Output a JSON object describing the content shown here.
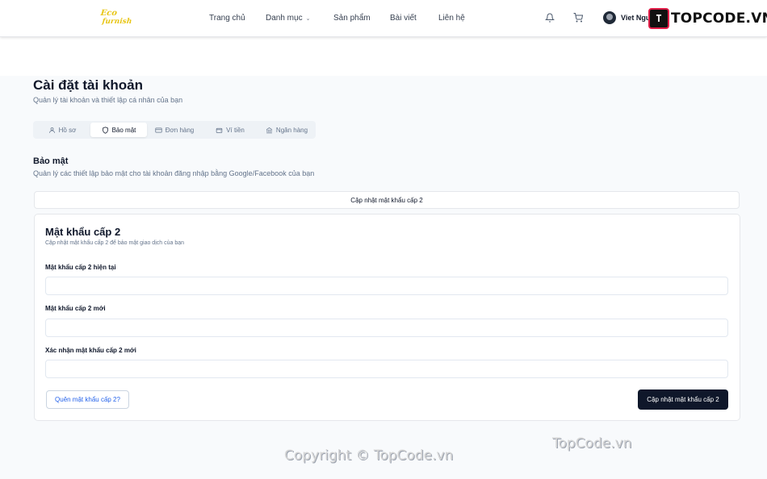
{
  "header": {
    "logo_line1": "Eco",
    "logo_line2": "furnish",
    "nav": [
      "Trang chủ",
      "Danh mục",
      "Sản phẩm",
      "Bài viết",
      "Liên hệ"
    ],
    "user_name": "Viet Ngu",
    "brand_mark": "T",
    "brand_text": "TOPCODE.VN"
  },
  "page": {
    "title": "Cài đặt tài khoản",
    "subtitle": "Quản lý tài khoản và thiết lập cá nhân của bạn"
  },
  "tabs": [
    {
      "label": "Hồ sơ",
      "icon": "user-icon"
    },
    {
      "label": "Bảo mật",
      "icon": "shield-icon"
    },
    {
      "label": "Đơn hàng",
      "icon": "card-icon"
    },
    {
      "label": "Ví tiền",
      "icon": "wallet-icon"
    },
    {
      "label": "Ngân hàng",
      "icon": "bank-icon"
    }
  ],
  "active_tab": "Bảo mật",
  "security": {
    "title": "Bảo mật",
    "subtitle": "Quản lý các thiết lập bảo mật cho tài khoản đăng nhập bằng Google/Facebook của bạn",
    "update_strip_label": "Cập nhật mật khẩu cấp 2"
  },
  "form": {
    "title": "Mật khẩu cấp 2",
    "subtitle": "Cập nhật mật khẩu cấp 2 để bảo mật giao dịch của bạn",
    "fields": [
      {
        "label": "Mật khẩu cấp 2 hiện tại",
        "value": ""
      },
      {
        "label": "Mật khẩu cấp 2 mới",
        "value": ""
      },
      {
        "label": "Xác nhận mật khẩu cấp 2 mới",
        "value": ""
      }
    ],
    "forgot_label": "Quên mật khẩu cấp 2?",
    "submit_label": "Cập nhật mật khẩu cấp 2"
  },
  "watermarks": {
    "top": "TopCode.vn",
    "bottom": "Copyright © TopCode.vn"
  },
  "colors": {
    "primary": "#0f172a",
    "link": "#2563eb",
    "logo": "#e8c514",
    "background": "#f8fafc"
  }
}
